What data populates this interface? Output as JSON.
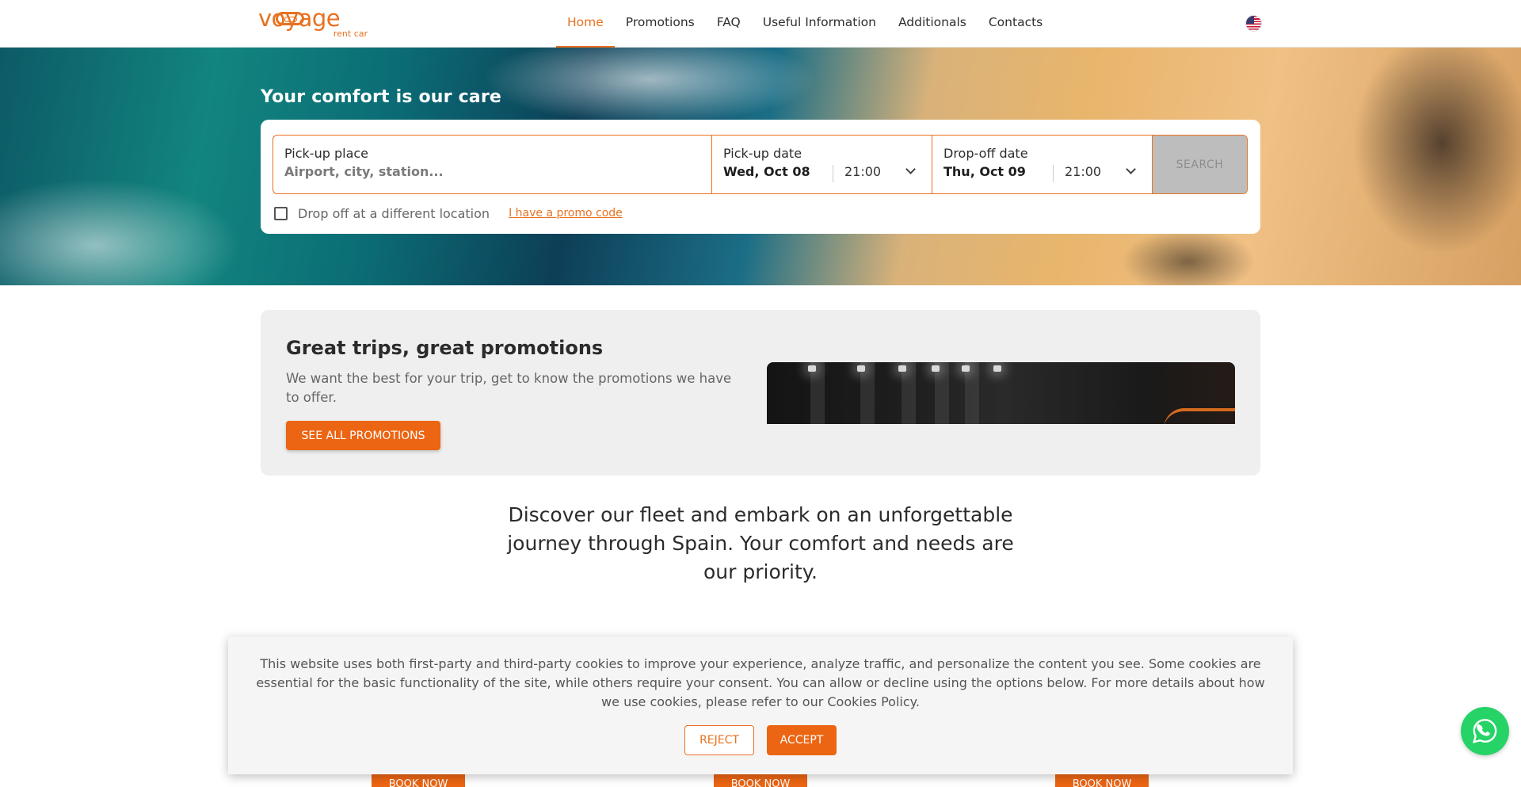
{
  "brand": {
    "name": "voyage",
    "tagline": "rent car",
    "color": "#e8711f"
  },
  "nav": {
    "items": [
      {
        "label": "Home",
        "active": true
      },
      {
        "label": "Promotions",
        "active": false
      },
      {
        "label": "FAQ",
        "active": false
      },
      {
        "label": "Useful Information",
        "active": false
      },
      {
        "label": "Additionals",
        "active": false
      },
      {
        "label": "Contacts",
        "active": false
      }
    ],
    "language_icon": "us-flag-icon"
  },
  "hero": {
    "title": "Your comfort is our care",
    "search": {
      "pickup_place_label": "Pick-up place",
      "pickup_place_placeholder": "Airport, city, station...",
      "pickup_date_label": "Pick-up date",
      "pickup_date": "Wed, Oct 08",
      "pickup_time": "21:00",
      "dropoff_date_label": "Drop-off date",
      "dropoff_date": "Thu, Oct 09",
      "dropoff_time": "21:00",
      "search_label": "SEARCH",
      "different_location_label": "Drop off at a different location",
      "promo_code_label": "I have a promo code"
    }
  },
  "promotions": {
    "title": "Great trips, great promotions",
    "text": "We want the best for your trip, get to know the promotions we have to offer.",
    "button_label": "SEE ALL PROMOTIONS"
  },
  "discover": {
    "text": "Discover our fleet and embark on an unforgettable journey through Spain. Your comfort and needs are our priority."
  },
  "fleet": {
    "book_labels": [
      "BOOK NOW",
      "BOOK NOW",
      "BOOK NOW"
    ]
  },
  "cookie_banner": {
    "text": "This website uses both first-party and third-party cookies to improve your experience, analyze traffic, and personalize the content you see. Some cookies are essential for the basic functionality of the site, while others require your consent. You can allow or decline using the options below. For more details about how we use cookies, please refer to our Cookies Policy.",
    "reject_label": "REJECT",
    "accept_label": "ACCEPT"
  },
  "chat": {
    "icon": "whatsapp-icon",
    "color": "#25d366"
  }
}
